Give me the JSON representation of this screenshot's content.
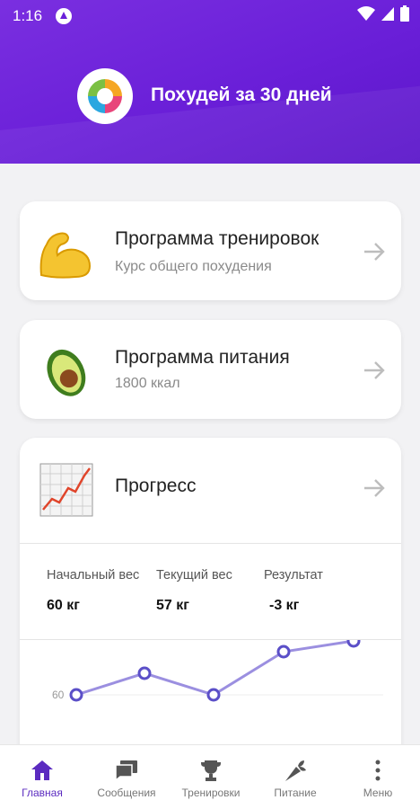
{
  "status_bar": {
    "time": "1:16"
  },
  "header": {
    "title": "Похудей за 30 дней"
  },
  "cards": {
    "training": {
      "title": "Программа тренировок",
      "subtitle": "Курс общего похудения",
      "icon": "flexed-biceps-icon"
    },
    "nutrition": {
      "title": "Программа питания",
      "subtitle": "1800 ккал",
      "icon": "avocado-icon"
    },
    "progress": {
      "title": "Прогресс",
      "icon": "chart-increasing-icon",
      "stats": [
        {
          "label": "Начальный вес",
          "value": "60 кг"
        },
        {
          "label": "Текущий вес",
          "value": "57 кг"
        },
        {
          "label": "Результат",
          "value": "-3 кг"
        }
      ]
    }
  },
  "chart_data": {
    "type": "line",
    "y_tick_labels": [
      "60"
    ],
    "series": [
      {
        "values": [
          60,
          59,
          60,
          58,
          57.5
        ]
      }
    ],
    "color": "#9b8fe0"
  },
  "bottom_nav": [
    {
      "label": "Главная",
      "icon": "home-icon",
      "active": true
    },
    {
      "label": "Сообщения",
      "icon": "messages-icon",
      "active": false
    },
    {
      "label": "Тренировки",
      "icon": "trophy-icon",
      "active": false
    },
    {
      "label": "Питание",
      "icon": "carrot-icon",
      "active": false
    },
    {
      "label": "Меню",
      "icon": "more-vertical-icon",
      "active": false
    }
  ],
  "colors": {
    "header": "#6a1fd8",
    "accent": "#5b2bc0",
    "chart_line": "#9b8fe0"
  }
}
